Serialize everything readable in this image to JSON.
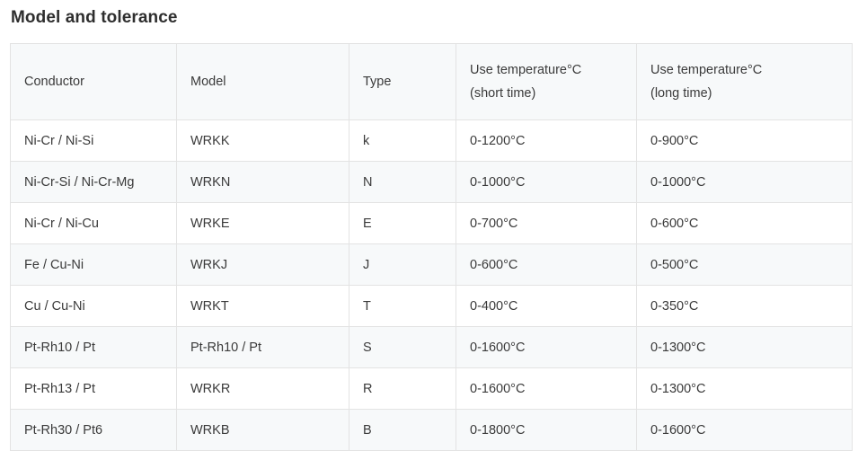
{
  "page": {
    "title": "Model and tolerance"
  },
  "colors": {
    "title_text": "#2e2e2e",
    "body_text": "#3a3a3a",
    "border": "#e3e3e3",
    "row_shaded_bg": "#f7f9fa",
    "row_plain_bg": "#ffffff",
    "page_bg": "#ffffff"
  },
  "table": {
    "headers": [
      {
        "line1": "Conductor",
        "line2": ""
      },
      {
        "line1": "Model",
        "line2": ""
      },
      {
        "line1": "Type",
        "line2": ""
      },
      {
        "line1": "Use temperature°C",
        "line2": "(short time)"
      },
      {
        "line1": "Use temperature°C",
        "line2": "(long time)"
      }
    ],
    "rows": [
      {
        "conductor": "Ni-Cr / Ni-Si",
        "model": "WRKK",
        "type": "k",
        "short_time": "0-1200°C",
        "long_time": "0-900°C",
        "shaded": false
      },
      {
        "conductor": "Ni-Cr-Si / Ni-Cr-Mg",
        "model": "WRKN",
        "type": "N",
        "short_time": "0-1000°C",
        "long_time": "0-1000°C",
        "shaded": true
      },
      {
        "conductor": "Ni-Cr / Ni-Cu",
        "model": "WRKE",
        "type": "E",
        "short_time": "0-700°C",
        "long_time": "0-600°C",
        "shaded": false
      },
      {
        "conductor": "Fe / Cu-Ni",
        "model": "WRKJ",
        "type": "J",
        "short_time": "0-600°C",
        "long_time": "0-500°C",
        "shaded": true
      },
      {
        "conductor": "Cu / Cu-Ni",
        "model": "WRKT",
        "type": "T",
        "short_time": "0-400°C",
        "long_time": "0-350°C",
        "shaded": false
      },
      {
        "conductor": "Pt-Rh10 / Pt",
        "model": "Pt-Rh10 / Pt",
        "type": "S",
        "short_time": "0-1600°C",
        "long_time": "0-1300°C",
        "shaded": true
      },
      {
        "conductor": "Pt-Rh13 / Pt",
        "model": "WRKR",
        "type": "R",
        "short_time": "0-1600°C",
        "long_time": "0-1300°C",
        "shaded": false
      },
      {
        "conductor": "Pt-Rh30 / Pt6",
        "model": "WRKB",
        "type": "B",
        "short_time": "0-1800°C",
        "long_time": "0-1600°C",
        "shaded": true
      }
    ]
  }
}
